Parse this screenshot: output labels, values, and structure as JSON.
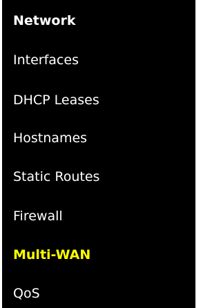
{
  "menu": {
    "heading": "Network",
    "items": [
      {
        "label": "Interfaces",
        "active": false
      },
      {
        "label": "DHCP Leases",
        "active": false
      },
      {
        "label": "Hostnames",
        "active": false
      },
      {
        "label": "Static Routes",
        "active": false
      },
      {
        "label": "Firewall",
        "active": false
      },
      {
        "label": "Multi-WAN",
        "active": true
      },
      {
        "label": "QoS",
        "active": false
      }
    ]
  },
  "colors": {
    "background": "#000000",
    "text": "#ffffff",
    "active_text": "#ffff00"
  }
}
